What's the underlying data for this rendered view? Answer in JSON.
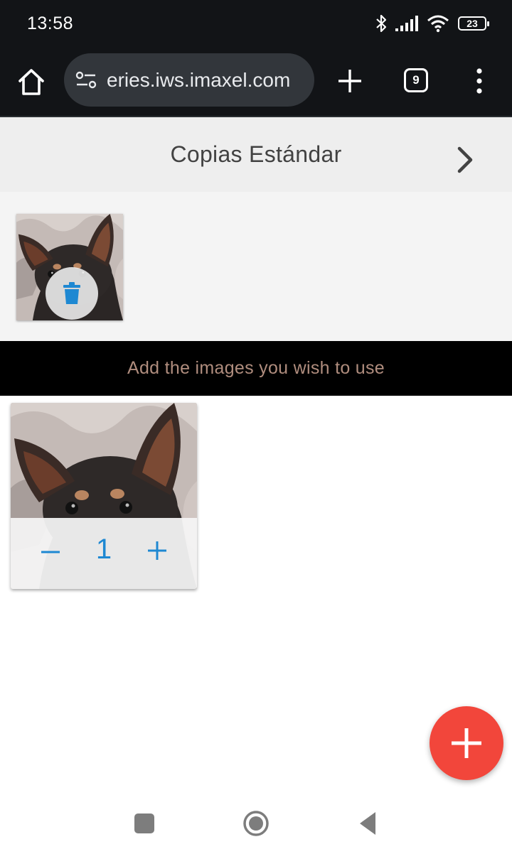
{
  "status_bar": {
    "time": "13:58",
    "battery_level": "23",
    "icons": [
      "bluetooth-icon",
      "signal-icon",
      "wifi-icon",
      "battery-icon"
    ]
  },
  "browser": {
    "url": "eries.iws.imaxel.com",
    "tab_count": "9",
    "icons": [
      "home-icon",
      "site-settings-icon",
      "new-tab-icon",
      "tab-switcher-icon",
      "menu-icon"
    ]
  },
  "header": {
    "title": "Copias Estándar",
    "next_icon": "chevron-right-icon"
  },
  "selected_tray": {
    "delete_icon": "trash-icon"
  },
  "banner": {
    "text": "Add the images you wish to use"
  },
  "photo_card": {
    "quantity": "1",
    "minus_icon": "minus-icon",
    "plus_icon": "plus-icon"
  },
  "fab": {
    "icon": "add-icon"
  },
  "colors": {
    "accent_blue": "#1e88d2",
    "fab_red": "#f2463b",
    "banner_text": "#b08d7e",
    "chrome_dark": "#121417"
  },
  "nav_bar": {
    "icons": [
      "recents-icon",
      "home-circle-icon",
      "back-icon"
    ]
  }
}
